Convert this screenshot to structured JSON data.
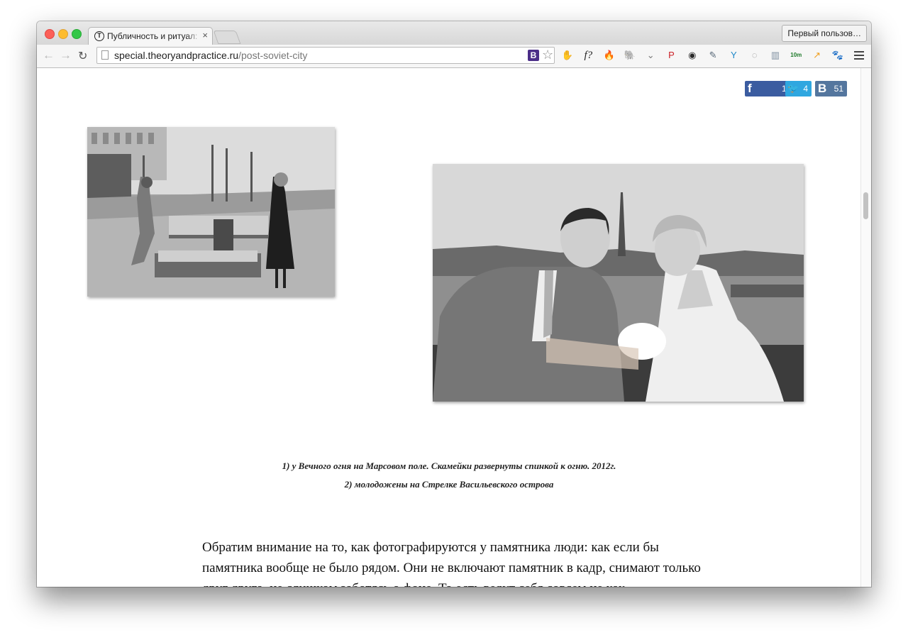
{
  "browser": {
    "tab_title": "Публичность и ритуал: Ил",
    "tab_favicon": "T",
    "tab_close": "×",
    "profile_button": "Первый пользов…",
    "url_host": "special.theoryandpractice.ru",
    "url_path": "/post-soviet-city",
    "omnibox_badge": "B",
    "icons": {
      "back": "←",
      "forward": "→",
      "reload": "↻",
      "star": "☆"
    },
    "extensions": [
      {
        "name": "adblock-icon",
        "glyph": "✋",
        "color": "#d23a2a"
      },
      {
        "name": "fx-icon",
        "glyph": "f?",
        "color": "#ffffff"
      },
      {
        "name": "fire-icon",
        "glyph": "🔥",
        "color": "#f28a1e"
      },
      {
        "name": "evernote-icon",
        "glyph": "🐘",
        "color": "#6e6e6e"
      },
      {
        "name": "pocket-icon",
        "glyph": "⌄",
        "color": "#7a7a7a"
      },
      {
        "name": "pinterest-icon",
        "glyph": "P",
        "color": "#cb2027"
      },
      {
        "name": "lens-icon",
        "glyph": "◉",
        "color": "#2a2a2a"
      },
      {
        "name": "eyedropper-icon",
        "glyph": "✎",
        "color": "#5a6a7a"
      },
      {
        "name": "y-icon",
        "glyph": "Y",
        "color": "#1e88c8"
      },
      {
        "name": "ring-icon",
        "glyph": "◌",
        "color": "#8a8a8a"
      },
      {
        "name": "book-icon",
        "glyph": "▥",
        "color": "#7e8fa0"
      },
      {
        "name": "timer-icon",
        "glyph": "10m",
        "color": "#1e7a2a"
      },
      {
        "name": "chart-icon",
        "glyph": "↗",
        "color": "#f0a020"
      },
      {
        "name": "paw-icon",
        "glyph": "🐾",
        "color": "#bbbbbb"
      }
    ]
  },
  "share": {
    "facebook_count": "120",
    "twitter_count": "4",
    "vk_count": "51",
    "facebook_glyph": "f",
    "twitter_glyph": "🐦",
    "vk_glyph": "B"
  },
  "article": {
    "caption_line1": "1) у Вечного огня на Марсовом поле. Скамейки развернуты спинкой к огню. 2012г.",
    "caption_line2": "2) молодожены на Стрелке Васильевского острова",
    "paragraph": "Обратим внимание на то, как фотографируются у памятника люди: как если бы памятника вообще не было рядом. Они не включают памятник в кадр, снимают только друг друга, не слишком заботясь о фоне. То есть ведут себя совсем не как"
  }
}
